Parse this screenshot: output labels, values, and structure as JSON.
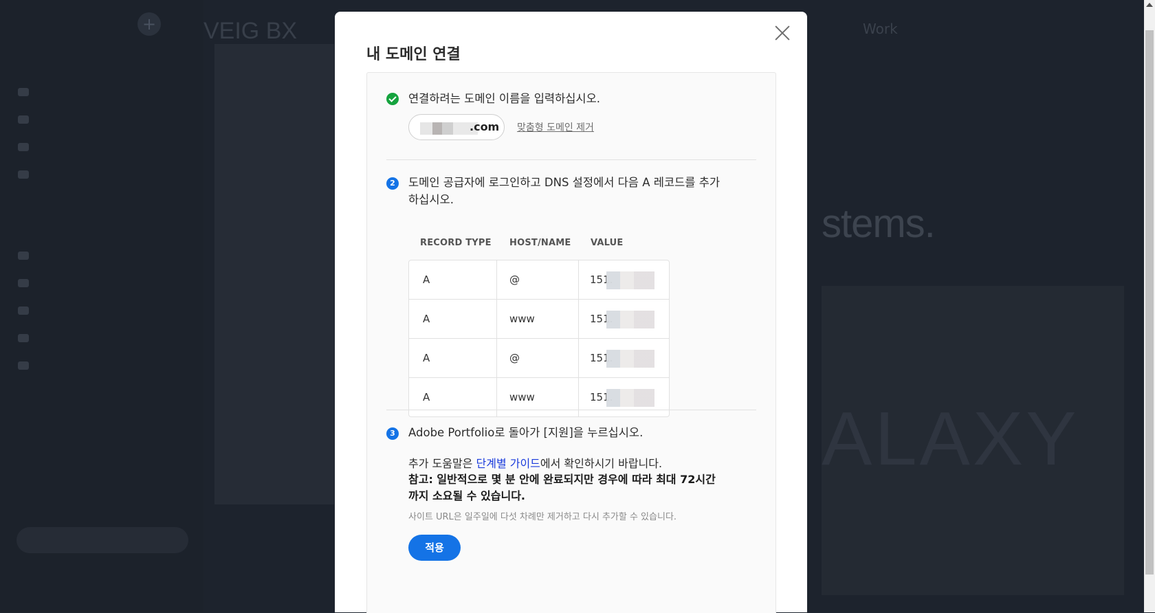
{
  "background": {
    "site_logo": "VEIG BX",
    "nav_word": "Work",
    "hero_fragment": "stems.",
    "hero_word": "ALAXY"
  },
  "modal": {
    "title": "내 도메인 연결",
    "close_icon": "close-icon",
    "step1": {
      "icon": "check-circle-icon",
      "text": "연결하려는 도메인 이름을 입력하십시오.",
      "domain_suffix": ".com",
      "remove_link": "맞춤형 도메인 제거"
    },
    "step2": {
      "number": "2",
      "text_line1": "도메인 공급자에 로그인하고 DNS 설정에서 다음 A 레코드를 추가",
      "text_line2": "하십시오.",
      "table": {
        "headers": [
          "RECORD TYPE",
          "HOST/NAME",
          "VALUE"
        ],
        "rows": [
          {
            "type": "A",
            "host": "@",
            "value": "151."
          },
          {
            "type": "A",
            "host": "www",
            "value": "151."
          },
          {
            "type": "A",
            "host": "@",
            "value": "151."
          },
          {
            "type": "A",
            "host": "www",
            "value": "151."
          }
        ]
      }
    },
    "step3": {
      "number": "3",
      "text": "Adobe Portfolio로 돌아가 [지원]을 누르십시오.",
      "help_prefix": "추가 도움말은 ",
      "help_link": "단계별 가이드",
      "help_suffix": "에서 확인하시기 바랍니다.",
      "note_line1": "참고: 일반적으로 몇 분 안에 완료되지만 경우에 따라 최대 72시간",
      "note_line2": "까지 소요될 수 있습니다.",
      "small_note": "사이트 URL은 일주일에 다섯 차례만 제거하고 다시 추가할 수 있습니다.",
      "apply_button": "적용"
    }
  }
}
